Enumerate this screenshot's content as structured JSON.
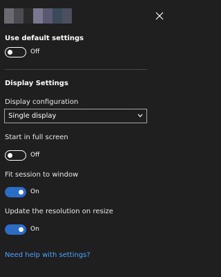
{
  "header": {
    "title_obscured_colors": [
      "#6a6a72",
      "#4e4a52",
      "#2a2a2a",
      "#7a7890",
      "#5a5870",
      "#3a4a5a",
      "#4a5060"
    ],
    "close_icon": "close-icon"
  },
  "default_settings": {
    "heading": "Use default settings",
    "toggle_state": "Off",
    "enabled": false
  },
  "display_settings": {
    "heading": "Display Settings",
    "configuration_label": "Display configuration",
    "configuration_value": "Single display",
    "full_screen_label": "Start in full screen",
    "full_screen_state": "Off",
    "full_screen_enabled": false,
    "fit_session_label": "Fit session to window",
    "fit_session_state": "On",
    "fit_session_enabled": true,
    "resize_label": "Update the resolution on resize",
    "resize_state": "On",
    "resize_enabled": true
  },
  "help": {
    "link_text": "Need help with settings?"
  },
  "colors": {
    "background": "#1f1f1f",
    "accent": "#2b6cc4",
    "link": "#4da3ff"
  }
}
